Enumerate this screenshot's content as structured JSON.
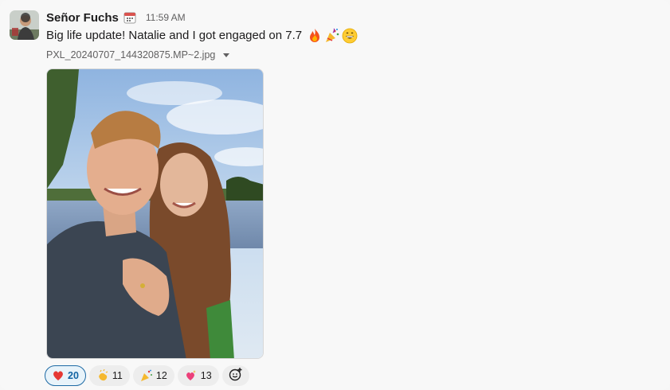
{
  "message": {
    "sender_name": "Señor Fuchs",
    "status_icon": "calendar-icon",
    "timestamp": "11:59 AM",
    "text": "Big life update! Natalie and I got engaged on 7.7",
    "text_emojis": [
      "fire-icon",
      "party-popper-icon",
      "grinning-face-icon"
    ]
  },
  "attachment": {
    "filename": "PXL_20240707_144320875.MP~2.jpg",
    "image_alt": "photo"
  },
  "reactions": [
    {
      "emoji": "red-heart-icon",
      "count": "20",
      "active": true
    },
    {
      "emoji": "clapping-hands-icon",
      "count": "11",
      "active": false
    },
    {
      "emoji": "party-popper-icon",
      "count": "12",
      "active": false
    },
    {
      "emoji": "sparkling-heart-icon",
      "count": "13",
      "active": false
    }
  ],
  "add_reaction_icon": "add-emoji-icon",
  "colors": {
    "link_blue": "#1264a3",
    "active_reaction_bg": "#e8f3fa"
  }
}
